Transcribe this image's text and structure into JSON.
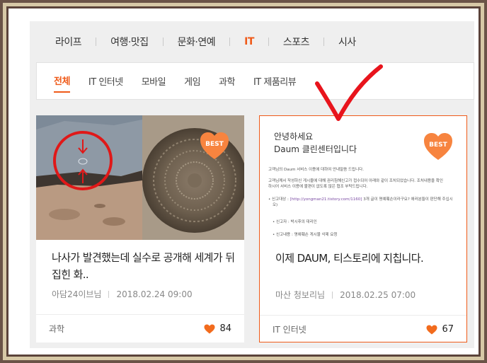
{
  "nav": {
    "categories": [
      {
        "label": "라이프"
      },
      {
        "label": "여행·맛집"
      },
      {
        "label": "문화·연예"
      },
      {
        "label": "IT"
      },
      {
        "label": "스포츠"
      },
      {
        "label": "시사"
      }
    ],
    "active_category": "IT"
  },
  "subnav": {
    "items": [
      {
        "label": "전체"
      },
      {
        "label": "IT 인터넷"
      },
      {
        "label": "모바일"
      },
      {
        "label": "게임"
      },
      {
        "label": "과학"
      },
      {
        "label": "IT 제품리뷰"
      }
    ],
    "active_item": "전체"
  },
  "colors": {
    "accent": "#ef5a19",
    "badge": "#f7843f",
    "annotation": "#e8141c"
  },
  "cards": [
    {
      "badge": "BEST",
      "title": "나사가 발견했는데 실수로 공개해 세계가 뒤집힌 화..",
      "author": "아담24이브님",
      "date": "2018.02.24 09:00",
      "category": "과학",
      "likes": "84",
      "like_icon": "heart-icon"
    },
    {
      "badge": "BEST",
      "title": "이제 DAUM, 티스토리에 지칩니다.",
      "author": "마산 청보리님",
      "date": "2018.02.25 07:00",
      "category": "IT 인터넷",
      "likes": "67",
      "like_icon": "heart-icon",
      "doc": {
        "greeting_1": "안녕하세요",
        "greeting_2": "Daum 클린센터입니다",
        "line_1": "고객님의 Daum 서비스 이용에 대하여 안내말씀 드립니다.",
        "line_2": "고객님께서 작성하신 게시물에 대해 권리침해신고가 접수되어 아래와 같이 조치되었습니다. 조치내용을 확인",
        "line_3": "하시어 서비스 이용에 불편이 없도록 많은 협조 부탁드립니다.",
        "line_4_prefix": "• 신고대상 : ",
        "line_4_link": "[http://yongman21.tistory.com/1160]",
        "line_4_suffix": " 3개 글이 명예훼손이라구요? 애러분들이 판단해 주십시",
        "line_5": "오)",
        "line_6": "• 신고자 : 박시후의 대리인",
        "line_7": "• 신고내용 : 명예훼손 게시물 삭제 요청"
      }
    }
  ]
}
